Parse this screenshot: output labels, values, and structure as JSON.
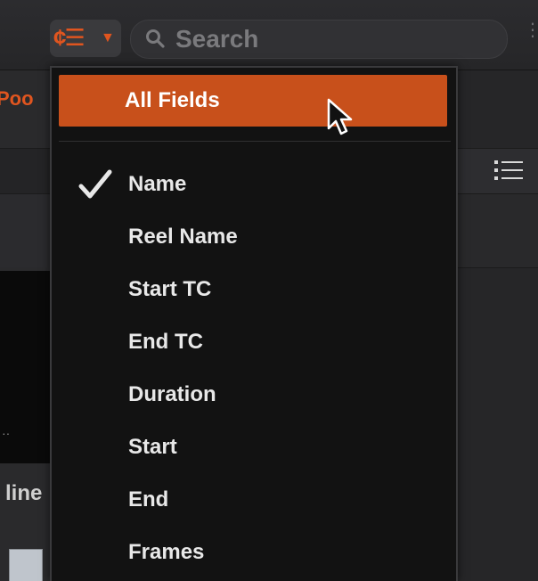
{
  "toolbar": {
    "filter_icon": "filter-options-icon",
    "search_placeholder": "Search"
  },
  "background": {
    "left_tab_label": "Poo",
    "left_row_label": "line"
  },
  "dropdown": {
    "all_fields_label": "All Fields",
    "items": [
      {
        "label": "Name",
        "checked": true
      },
      {
        "label": "Reel Name",
        "checked": false
      },
      {
        "label": "Start TC",
        "checked": false
      },
      {
        "label": "End TC",
        "checked": false
      },
      {
        "label": "Duration",
        "checked": false
      },
      {
        "label": "Start",
        "checked": false
      },
      {
        "label": "End",
        "checked": false
      },
      {
        "label": "Frames",
        "checked": false
      }
    ]
  },
  "colors": {
    "accent": "#c8501b",
    "accent_icon": "#e0551f",
    "menu_bg": "#121212"
  }
}
